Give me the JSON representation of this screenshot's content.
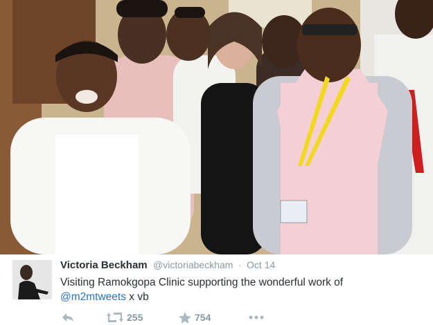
{
  "tweet": {
    "author": {
      "display_name": "Victoria Beckham",
      "screen_name": "@victoriabeckham"
    },
    "separator": "·",
    "timestamp": "Oct 14",
    "text_part1": "Visiting Ramokgopa Clinic supporting the wonderful work of",
    "mention": "@m2mtweets",
    "text_part2": " x vb",
    "actions": {
      "reply_icon": "reply-arrow",
      "retweet_icon": "retweet-arrows",
      "retweet_count": "255",
      "favorite_icon": "star",
      "favorite_count": "754",
      "more_icon": "ellipsis"
    },
    "colors": {
      "name": "#292f33",
      "meta": "#8899a6",
      "mention": "#2a74c2"
    }
  }
}
